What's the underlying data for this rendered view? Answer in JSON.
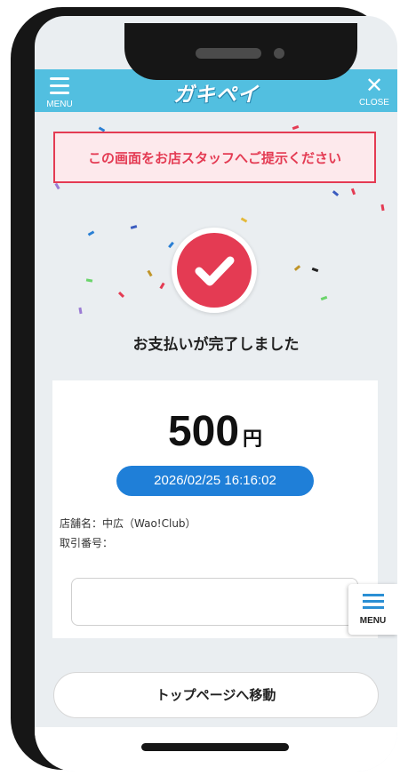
{
  "header": {
    "menu_label": "MENU",
    "logo_text": "ガキペイ",
    "close_label": "CLOSE",
    "brand_color": "#52bfe0"
  },
  "notice": {
    "text": "この画面をお店スタッフへご提示ください",
    "color": "#e43b53"
  },
  "status": {
    "icon": "check-icon",
    "message": "お支払いが完了しました"
  },
  "payment": {
    "amount": "500",
    "unit": "円",
    "datetime": "2026/02/25 16:16:02",
    "store_line": "店舗名：中広（Wao!Club）",
    "transaction_line": "取引番号："
  },
  "floating_menu": {
    "label": "MENU",
    "icon": "hamburger-icon"
  },
  "actions": {
    "top_button": "トップページへ移動"
  }
}
